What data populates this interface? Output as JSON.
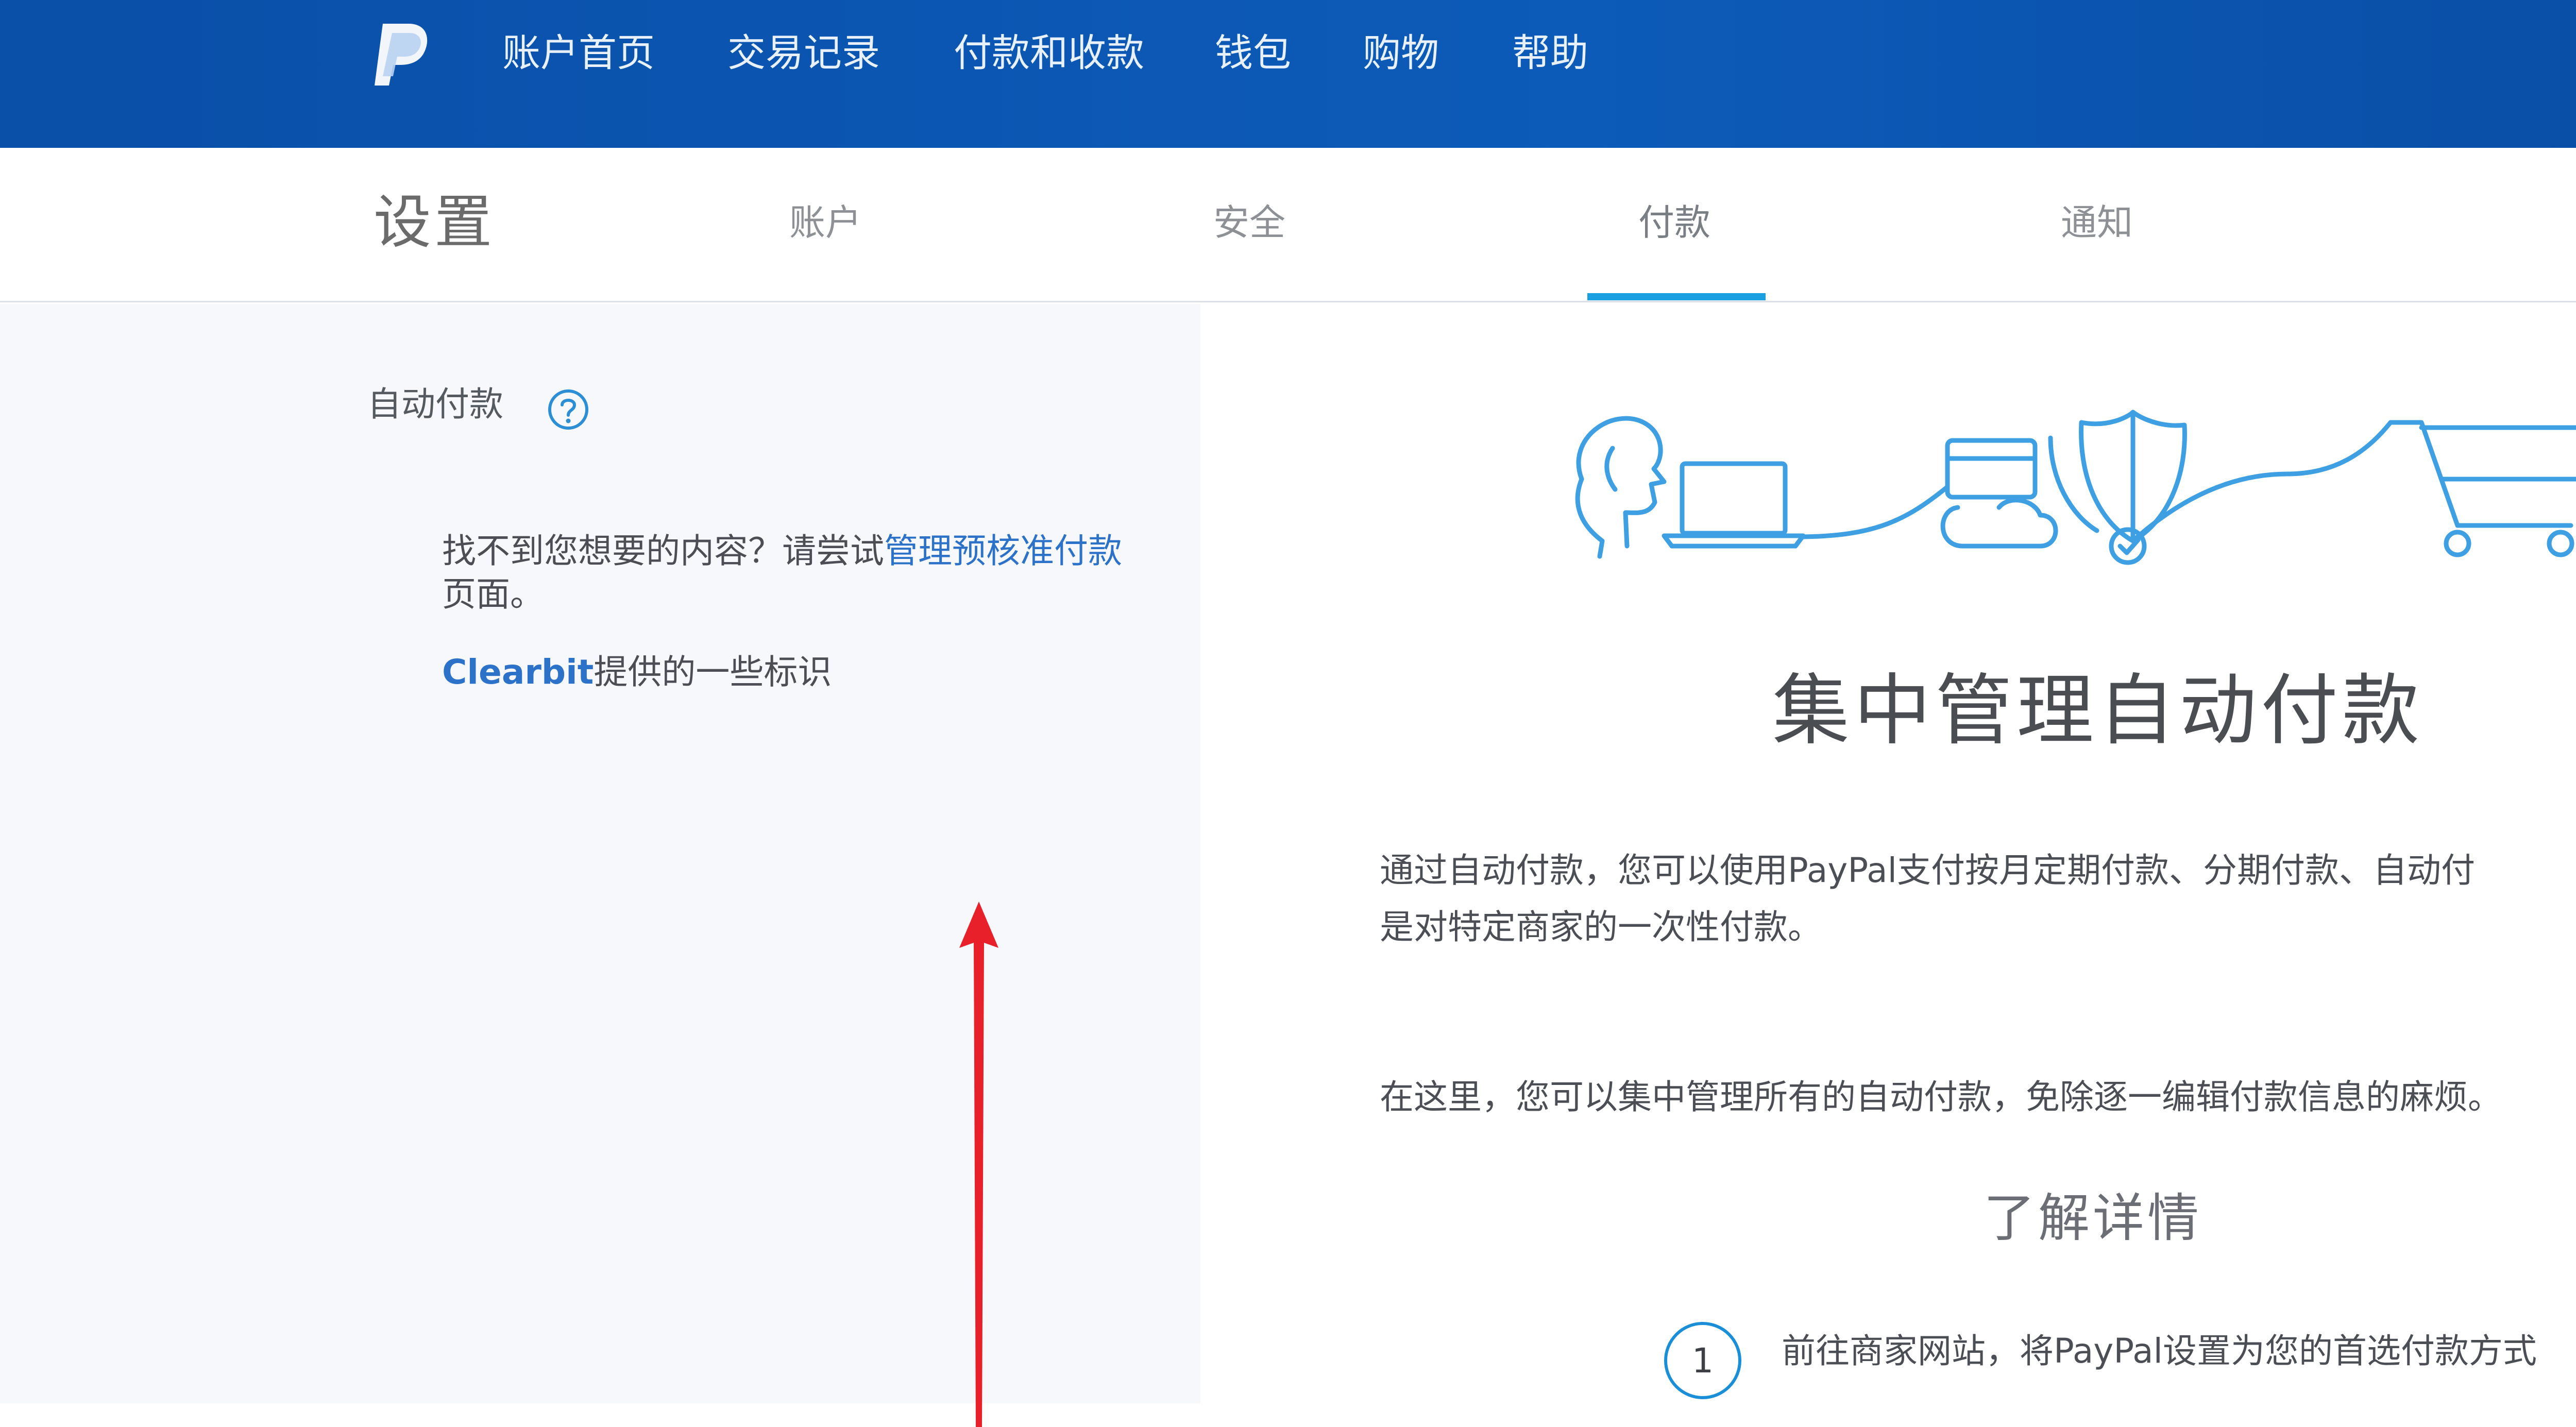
{
  "nav": {
    "items": [
      "账户首页",
      "交易记录",
      "付款和收款",
      "钱包",
      "购物",
      "帮助"
    ]
  },
  "settings": {
    "title": "设置",
    "tabs": [
      "账户",
      "安全",
      "付款",
      "通知"
    ],
    "active_tab": "付款"
  },
  "left": {
    "section_title": "自动付款",
    "hint_prefix": "找不到您想要的内容？请尝试",
    "hint_link": "管理预核准付款",
    "hint_suffix": "页面。",
    "clearbit_brand": "Clearbit",
    "clearbit_suffix": "提供的一些标识"
  },
  "main": {
    "title": "集中管理自动付款",
    "paragraph1_line1": "通过自动付款，您可以使用PayPal支付按月定期付款、分期付款、自动付",
    "paragraph1_line2": "是对特定商家的一次性付款。",
    "paragraph2": "在这里，您可以集中管理所有的自动付款，免除逐一编辑付款信息的麻烦。",
    "learn_more": "了解详情",
    "step1_number": "1",
    "step1_text": "前往商家网站，将PayPal设置为您的首选付款方式"
  },
  "colors": {
    "nav_bg": "#0c5bb8",
    "accent": "#1a9fe0",
    "link": "#2c72c9",
    "annotation_arrow": "#e8202a"
  }
}
